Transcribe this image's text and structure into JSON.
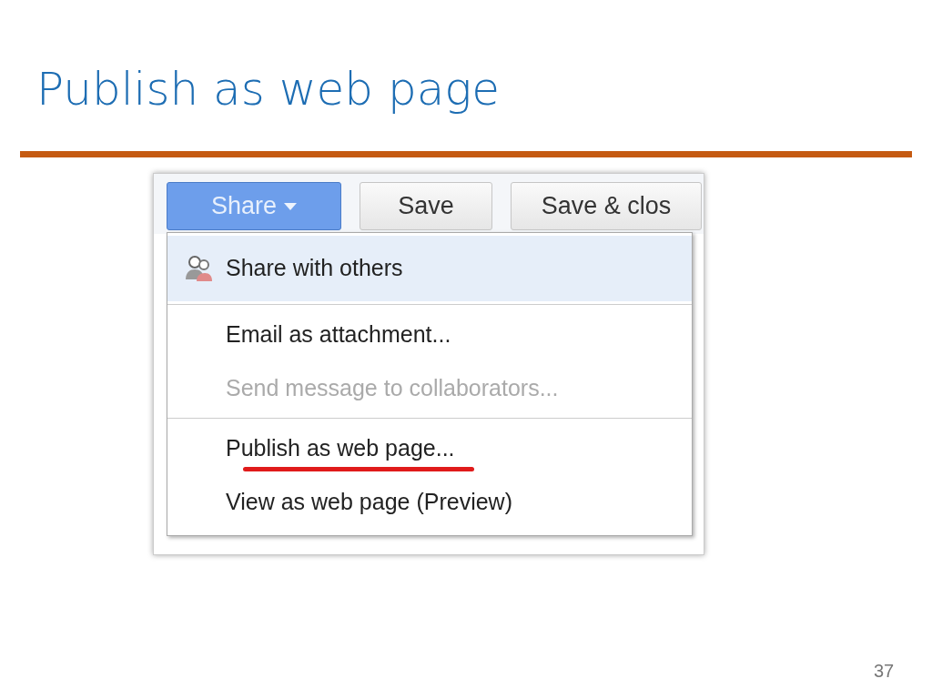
{
  "slide": {
    "title": "Publish as web page",
    "page_number": "37"
  },
  "toolbar": {
    "buttons": [
      {
        "label": "Share",
        "kind": "menu",
        "pressed": true
      },
      {
        "label": "Save",
        "kind": "plain",
        "pressed": false
      },
      {
        "label": "Save & clos",
        "kind": "plain",
        "pressed": false
      }
    ]
  },
  "menu": {
    "groups": [
      {
        "items": [
          {
            "label": "Share with others",
            "icon": true,
            "highlighted": true,
            "disabled": false,
            "underlined": false
          }
        ]
      },
      {
        "items": [
          {
            "label": "Email as attachment...",
            "icon": false,
            "highlighted": false,
            "disabled": false,
            "underlined": false
          },
          {
            "label": "Send message to collaborators...",
            "icon": false,
            "highlighted": false,
            "disabled": true,
            "underlined": false
          }
        ]
      },
      {
        "items": [
          {
            "label": "Publish as web page...",
            "icon": false,
            "highlighted": false,
            "disabled": false,
            "underlined": true
          },
          {
            "label": "View as web page (Preview)",
            "icon": false,
            "highlighted": false,
            "disabled": false,
            "underlined": false
          }
        ]
      }
    ]
  }
}
